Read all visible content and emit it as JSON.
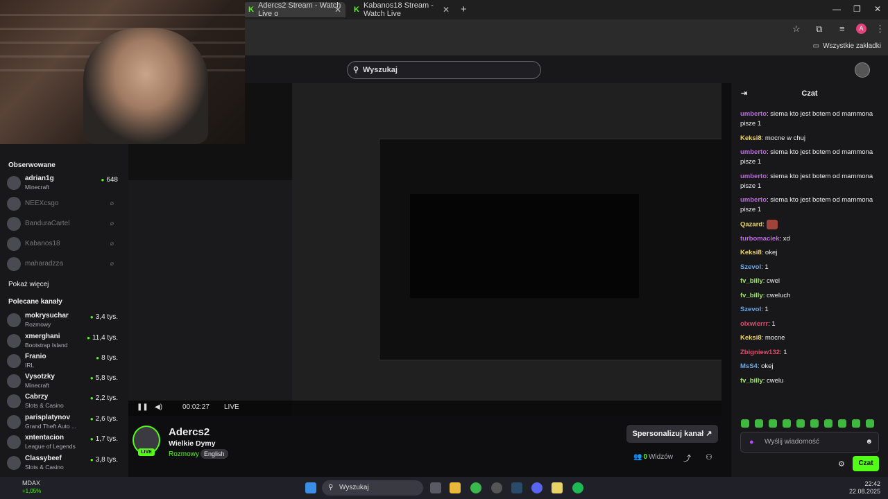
{
  "browser": {
    "tabs": [
      {
        "label": "Adercs2 Stream - Watch Live o",
        "active": true
      },
      {
        "label": "Kabanos18 Stream - Watch Live",
        "active": false
      }
    ],
    "bookmarks_label": "Wszystkie zakładki",
    "profile_initial": "A"
  },
  "site": {
    "search_placeholder": "Wyszukaj"
  },
  "sidebar": {
    "followed_heading": "Obserwowane",
    "followed": [
      {
        "name": "adrian1g",
        "category": "Minecraft",
        "viewers": "648",
        "live": true
      },
      {
        "name": "NEEXcsgo",
        "live": false
      },
      {
        "name": "BanduraCartel",
        "live": false
      },
      {
        "name": "Kabanos18",
        "live": false
      },
      {
        "name": "maharadzza",
        "live": false
      }
    ],
    "show_more": "Pokaż więcej",
    "recommended_heading": "Polecane kanały",
    "recommended": [
      {
        "name": "mokrysuchar",
        "category": "Rozmowy",
        "viewers": "3,4 tys."
      },
      {
        "name": "xmerghani",
        "category": "Bootstrap Island",
        "viewers": "11,4 tys."
      },
      {
        "name": "Franio",
        "category": "IRL",
        "viewers": "8 tys."
      },
      {
        "name": "Vysotzky",
        "category": "Minecraft",
        "viewers": "5,8 tys."
      },
      {
        "name": "Cabrzy",
        "category": "Slots & Casino",
        "viewers": "2,2 tys."
      },
      {
        "name": "parisplatynov",
        "category": "Grand Theft Auto ...",
        "viewers": "2,6 tys."
      },
      {
        "name": "xntentacion",
        "category": "League of Legends",
        "viewers": "1,7 tys."
      },
      {
        "name": "Classybeef",
        "category": "Slots & Casino",
        "viewers": "3,8 tys."
      }
    ]
  },
  "player": {
    "time": "00:02:27",
    "live_label": "LIVE"
  },
  "stream": {
    "streamer": "Adercs2",
    "title": "Wielkie Dymy",
    "category": "Rozmowy",
    "tag": "English",
    "live_badge": "LIVE",
    "personalize_label": "Spersonalizuj kanał",
    "viewers_count": "0",
    "viewers_label": "Widzów"
  },
  "chat": {
    "title": "Czat",
    "messages": [
      {
        "user": "umberto",
        "color": "#b96ad9",
        "text": "siema kto jest botem od mammona pisze 1"
      },
      {
        "user": "Keksi8",
        "color": "#e8d36a",
        "text": "mocne w chuj"
      },
      {
        "user": "umberto",
        "color": "#b96ad9",
        "text": "siema kto jest botem od mammona pisze 1"
      },
      {
        "user": "umberto",
        "color": "#b96ad9",
        "text": "siema kto jest botem od mammona pisze 1"
      },
      {
        "user": "umberto",
        "color": "#b96ad9",
        "text": "siema kto jest botem od mammona pisze 1"
      },
      {
        "user": "Qazard",
        "color": "#e8d36a",
        "text": "",
        "emote": true
      },
      {
        "user": "turbomaciek",
        "color": "#b96ad9",
        "text": "xd"
      },
      {
        "user": "Keksi8",
        "color": "#e8d36a",
        "text": "okej"
      },
      {
        "user": "Szevol",
        "color": "#6aa8e8",
        "text": "1"
      },
      {
        "user": "fv_billy",
        "color": "#9ee86a",
        "text": "cwel"
      },
      {
        "user": "fv_billy",
        "color": "#9ee86a",
        "text": "cweluch"
      },
      {
        "user": "Szevol",
        "color": "#6aa8e8",
        "text": "1"
      },
      {
        "user": "olxwierrr",
        "color": "#e84a6a",
        "text": "1"
      },
      {
        "user": "Keksi8",
        "color": "#e8d36a",
        "text": "mocne"
      },
      {
        "user": "Zbigniew132",
        "color": "#e84a6a",
        "text": "1"
      },
      {
        "user": "MsS4",
        "color": "#6aa8e8",
        "text": "okej"
      },
      {
        "user": "fv_billy",
        "color": "#9ee86a",
        "text": "cwelu"
      }
    ],
    "input_placeholder": "Wyślij wiadomość",
    "send_label": "Czat"
  },
  "taskbar": {
    "stock_name": "MDAX",
    "stock_change": "+1,05%",
    "search_label": "Wyszukaj",
    "time": "22:42",
    "date": "22.08.2025"
  },
  "colors": {
    "accent": "#53fc18",
    "background": "#0e0e10",
    "panel": "#18181b"
  }
}
